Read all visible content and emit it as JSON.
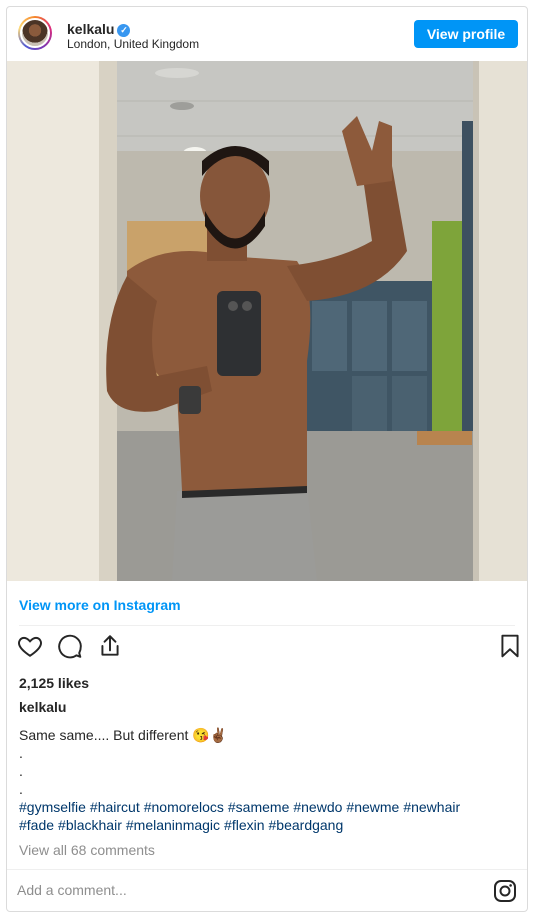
{
  "header": {
    "username": "kelkalu",
    "verified_mark": "✓",
    "location": "London, United Kingdom",
    "view_profile_label": "View profile"
  },
  "photo": {
    "description_icon": "gym-locker-room-mirror-selfie"
  },
  "view_more_label": "View more on Instagram",
  "actions": {
    "like_icon": "heart-icon",
    "comment_icon": "comment-icon",
    "share_icon": "share-icon",
    "save_icon": "bookmark-icon"
  },
  "likes": "2,125 likes",
  "caption": {
    "username": "kelkalu",
    "text": "Same same.... But different 😘✌🏾",
    "dots": [
      ".",
      ".",
      "."
    ],
    "hashtags_line1": [
      "#gymselfie",
      "#haircut",
      "#nomorelocs",
      "#sameme",
      "#newdo",
      "#newme",
      "#newhair"
    ],
    "hashtags_line2": [
      "#fade",
      "#blackhair",
      "#melaninmagic",
      "#flexin",
      "#beardgang"
    ]
  },
  "comments_link": "View all 68 comments",
  "add_comment_placeholder": "Add a comment...",
  "colors": {
    "accent": "#0095f6",
    "hashtag": "#00376b",
    "muted": "#8e8e8e",
    "border": "#dbdbdb"
  }
}
